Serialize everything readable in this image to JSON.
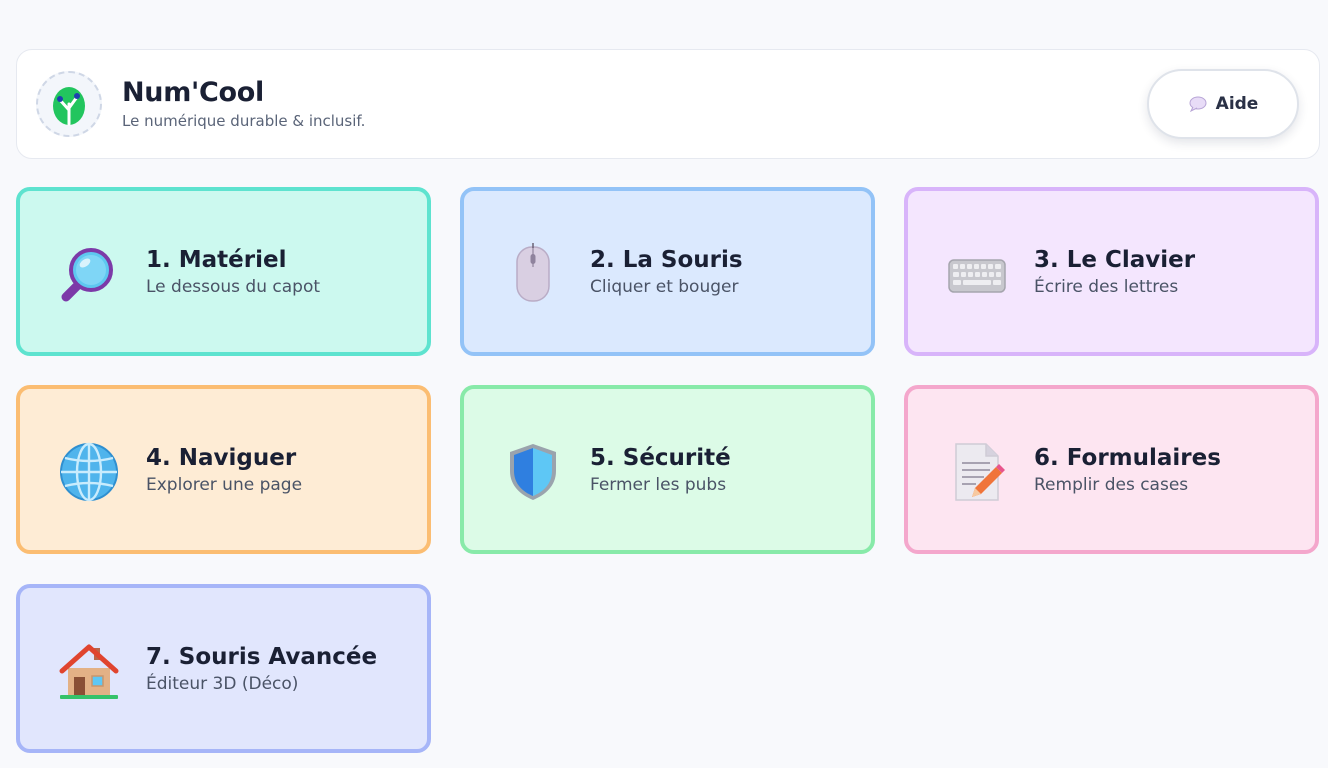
{
  "header": {
    "title": "Num'Cool",
    "subtitle": "Le numérique durable & inclusif.",
    "help_label": "Aide"
  },
  "modules": [
    {
      "title": "1. Matériel",
      "subtitle": "Le dessous du capot",
      "icon": "magnifier-icon",
      "bg": "#ccf9ef",
      "border": "#5ee3cf"
    },
    {
      "title": "2. La Souris",
      "subtitle": "Cliquer et bouger",
      "icon": "mouse-icon",
      "bg": "#dbe9fe",
      "border": "#93c3f7"
    },
    {
      "title": "3. Le Clavier",
      "subtitle": "Écrire des lettres",
      "icon": "keyboard-icon",
      "bg": "#f4e6fe",
      "border": "#d8b4fa"
    },
    {
      "title": "4. Naviguer",
      "subtitle": "Explorer une page",
      "icon": "globe-icon",
      "bg": "#feecd5",
      "border": "#fbbd72"
    },
    {
      "title": "5. Sécurité",
      "subtitle": "Fermer les pubs",
      "icon": "shield-icon",
      "bg": "#dcfbe7",
      "border": "#88eaa9"
    },
    {
      "title": "6. Formulaires",
      "subtitle": "Remplir des cases",
      "icon": "form-icon",
      "bg": "#fde5f1",
      "border": "#f4a7cc"
    },
    {
      "title": "7. Souris Avancée",
      "subtitle": "Éditeur 3D (Déco)",
      "icon": "house-icon",
      "bg": "#e1e6fd",
      "border": "#a6b5f8"
    }
  ]
}
